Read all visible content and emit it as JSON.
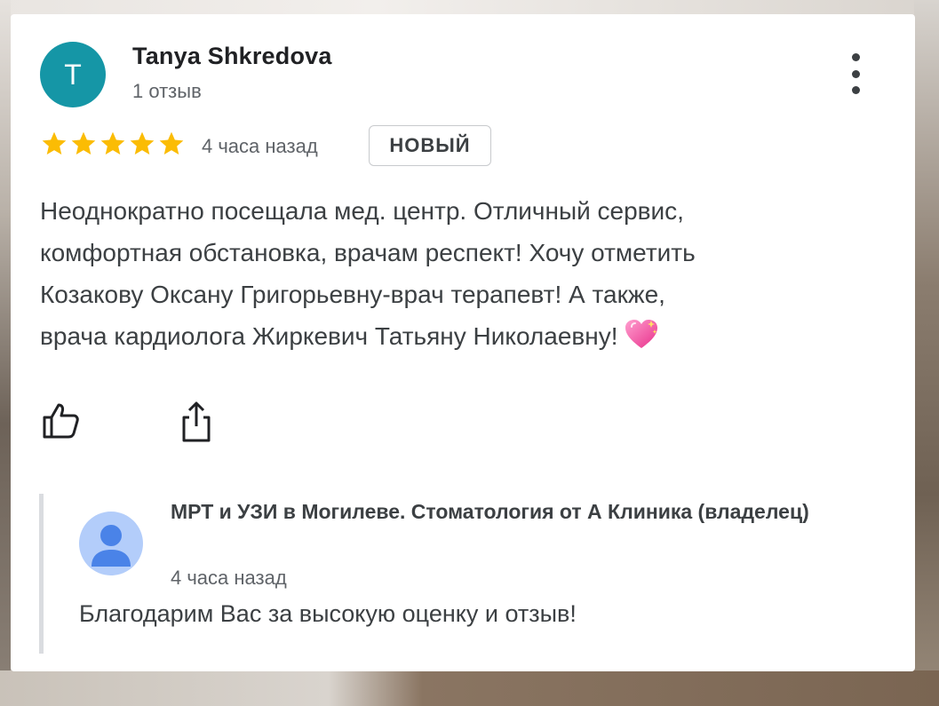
{
  "review": {
    "author": {
      "initial": "T",
      "name": "Tanya Shkredova",
      "meta": "1 отзыв"
    },
    "rating": 5,
    "max_rating": 5,
    "time": "4 часа назад",
    "badge": "НОВЫЙ",
    "text_lines": [
      "Неоднократно посещала мед. центр. Отличный сервис,",
      "комфортная обстановка, врачам респект! Хочу отметить",
      "Козакову Оксану Григорьевну-врач терапевт! А также,",
      "врача кардиолога Жиркевич Татьяну Николаевну!"
    ],
    "emoji": "sparkling-heart"
  },
  "reply": {
    "owner_name": "МРТ и УЗИ в Могилеве. Стоматология от А Клиника (владелец)",
    "time": "4 часа назад",
    "text": "Благодарим Вас за высокую оценку и отзыв!"
  },
  "colors": {
    "avatar": "#1596a6",
    "star": "#fbbc04",
    "owner_avatar_bg": "#b3cdfa",
    "owner_avatar_figure": "#4a83e8"
  }
}
